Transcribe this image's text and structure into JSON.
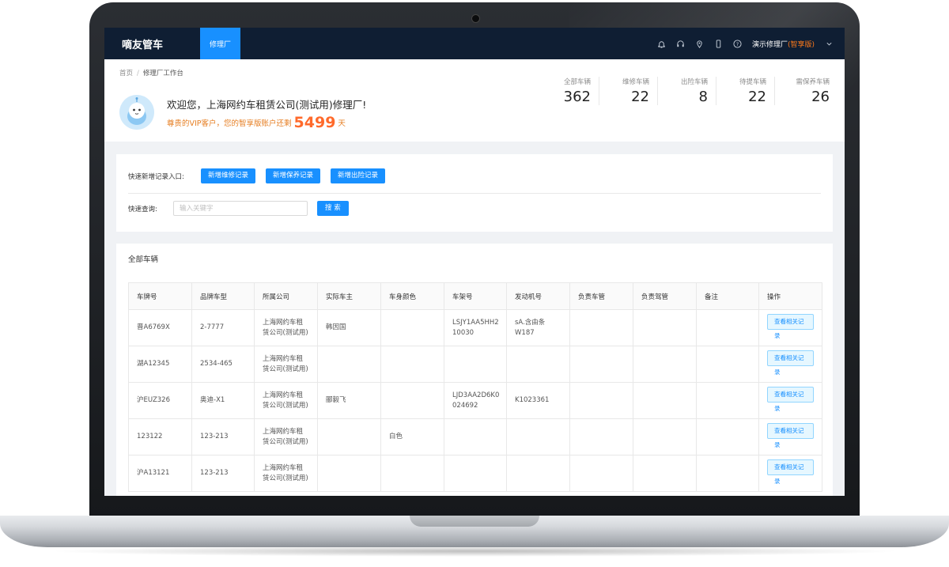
{
  "app": {
    "logo": "嘀友管车",
    "nav_tab": "修理厂",
    "user_name": "演示修理厂",
    "edition": "(智享版)"
  },
  "breadcrumb": {
    "home": "首页",
    "separator": "/",
    "current": "修理厂工作台"
  },
  "welcome": {
    "greeting": "欢迎您，上海网约车租赁公司(测试用)修理厂!",
    "vip_prefix": "尊贵的VIP客户，您的智享版账户还剩",
    "days": "5499",
    "days_unit": "天"
  },
  "stats": [
    {
      "label": "全部车辆",
      "value": "362"
    },
    {
      "label": "维修车辆",
      "value": "22"
    },
    {
      "label": "出险车辆",
      "value": "8"
    },
    {
      "label": "待提车辆",
      "value": "22"
    },
    {
      "label": "需保养车辆",
      "value": "26"
    }
  ],
  "quick": {
    "add_label": "快速新增记录入口:",
    "buttons": [
      "新增维修记录",
      "新增保养记录",
      "新增出险记录"
    ],
    "search_label": "快速查询:",
    "search_placeholder": "输入关键字",
    "search_button": "搜 索"
  },
  "vehicles": {
    "title": "全部车辆",
    "columns": [
      "车牌号",
      "品牌车型",
      "所属公司",
      "实际车主",
      "车身颜色",
      "车架号",
      "发动机号",
      "负责车管",
      "负责驾管",
      "备注",
      "操作"
    ],
    "action_label": "查看相关记录",
    "rows": [
      {
        "plate": "晋A6769X",
        "model": "2-7777",
        "company_l1": "上海网约车租",
        "company_l2": "赁公司(测试用)",
        "owner": "韩因国",
        "color": "",
        "vin_l1": "LSJY1AA5HH2",
        "vin_l2": "10030",
        "engine_l1": "sA.含由条",
        "engine_l2": "W187",
        "manager": "",
        "driver_mgr": "",
        "note": ""
      },
      {
        "plate": "湖A12345",
        "model": "2534-465",
        "company_l1": "上海网约车租",
        "company_l2": "赁公司(测试用)",
        "owner": "",
        "color": "",
        "vin_l1": "",
        "vin_l2": "",
        "engine_l1": "",
        "engine_l2": "",
        "manager": "",
        "driver_mgr": "",
        "note": ""
      },
      {
        "plate": "沪EUZ326",
        "model": "奥迪-X1",
        "company_l1": "上海网约车租",
        "company_l2": "赁公司(测试用)",
        "owner": "郦毅飞",
        "color": "",
        "vin_l1": "LJD3AA2D6K0",
        "vin_l2": "024692",
        "engine_l1": "K1023361",
        "engine_l2": "",
        "manager": "",
        "driver_mgr": "",
        "note": ""
      },
      {
        "plate": "123122",
        "model": "123-213",
        "company_l1": "上海网约车租",
        "company_l2": "赁公司(测试用)",
        "owner": "",
        "color": "白色",
        "vin_l1": "",
        "vin_l2": "",
        "engine_l1": "",
        "engine_l2": "",
        "manager": "",
        "driver_mgr": "",
        "note": ""
      },
      {
        "plate": "沪A13121",
        "model": "123-213",
        "company_l1": "上海网约车租",
        "company_l2": "赁公司(测试用)",
        "owner": "",
        "color": "",
        "vin_l1": "",
        "vin_l2": "",
        "engine_l1": "",
        "engine_l2": "",
        "manager": "",
        "driver_mgr": "",
        "note": ""
      }
    ]
  },
  "icons": [
    "bell-icon",
    "headset-icon",
    "location-icon",
    "phone-icon",
    "help-icon",
    "chevron-down-icon"
  ]
}
